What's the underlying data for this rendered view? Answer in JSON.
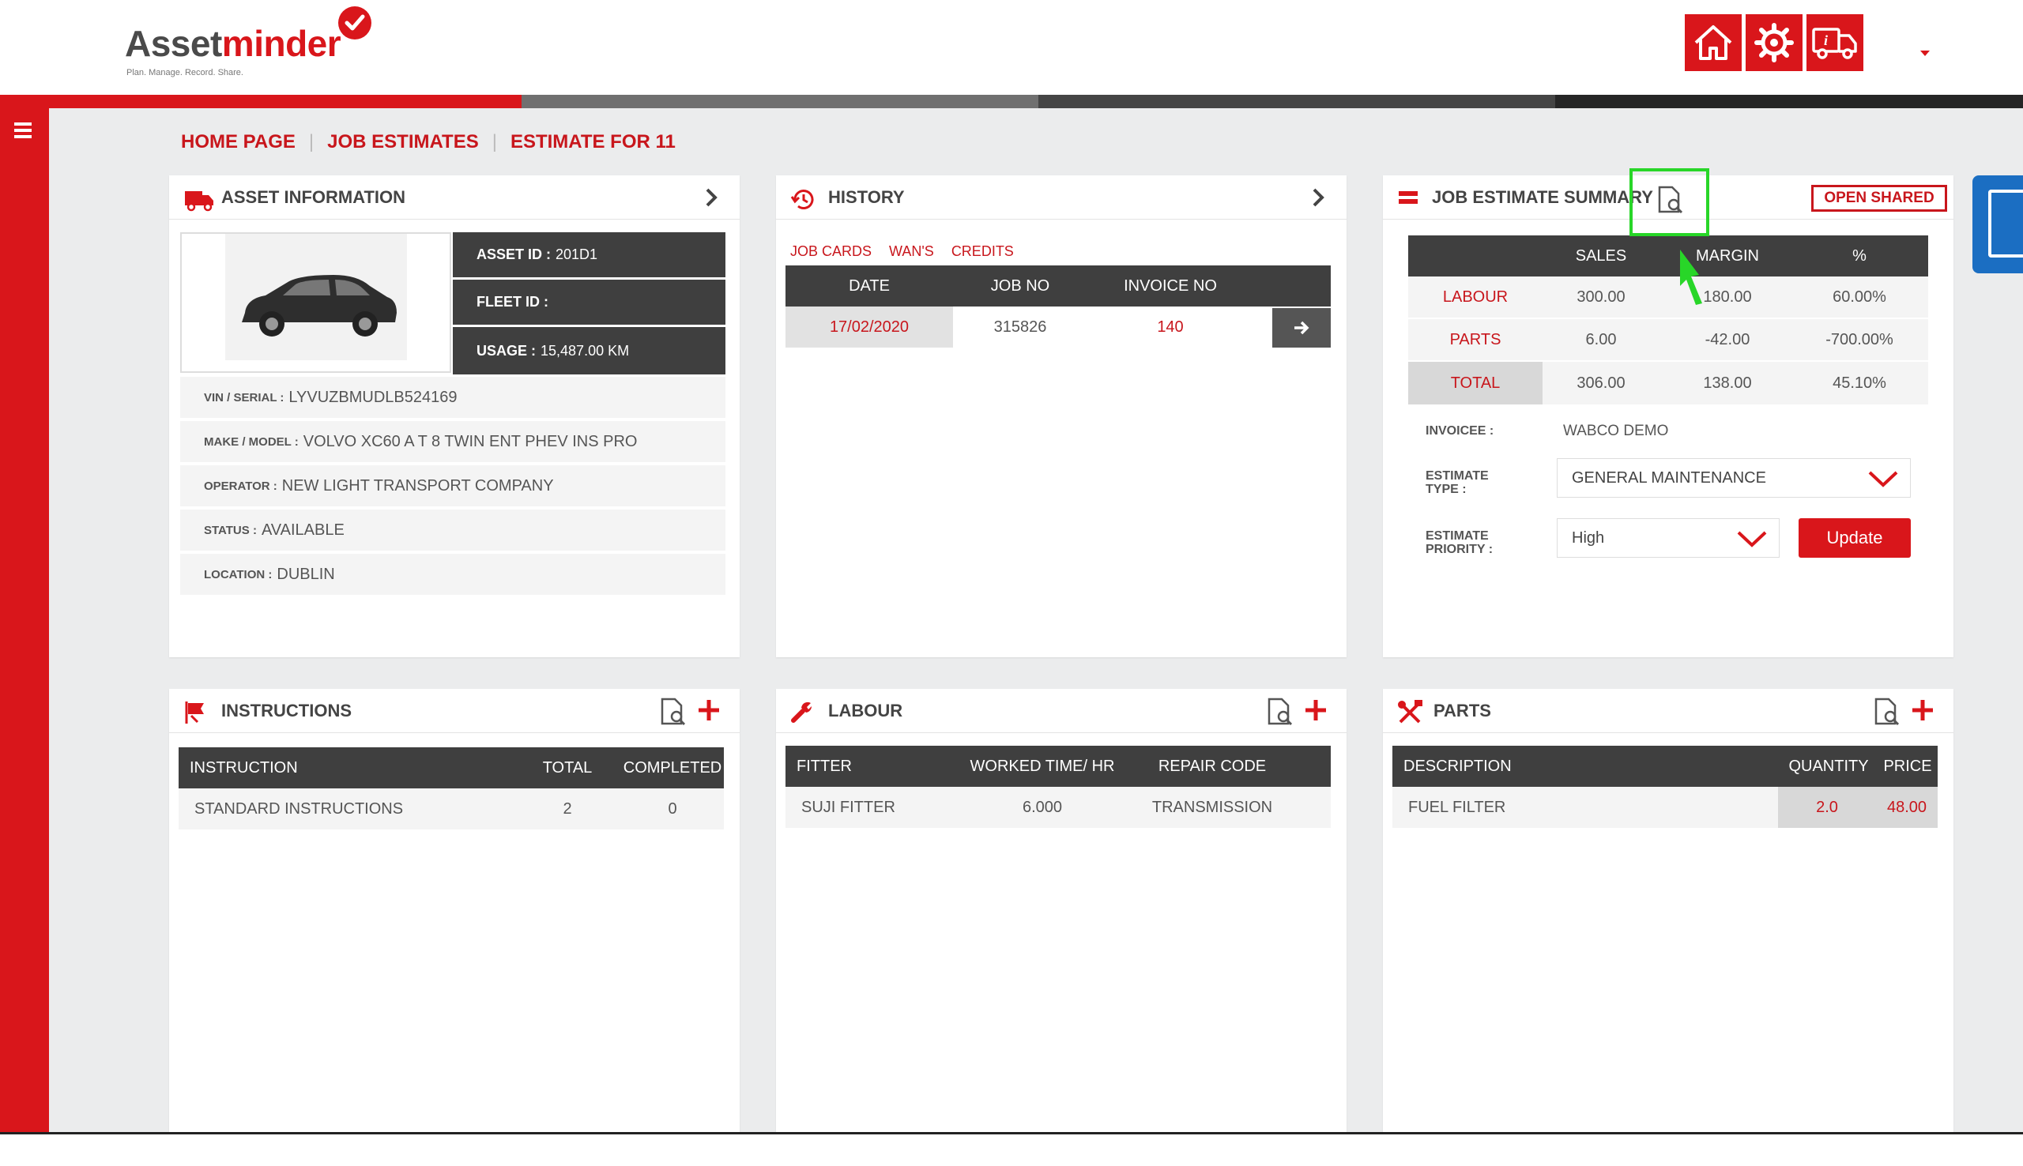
{
  "header": {
    "logo_prefix": "Asset",
    "logo_suffix": "minder",
    "logo_tagline": "Plan. Manage. Record. Share.",
    "buttons": [
      {
        "icon": "home-icon"
      },
      {
        "icon": "settings-gear-icon"
      },
      {
        "icon": "truck-info-icon"
      }
    ]
  },
  "colors": {
    "brand_red": "#d9161b",
    "dark": "#3f3f3f",
    "highlight": "#28d628",
    "side_tab": "#1b6ec2"
  },
  "breadcrumb": {
    "items": [
      "HOME PAGE",
      "JOB ESTIMATES",
      "ESTIMATE FOR 11"
    ],
    "separator": "|"
  },
  "asset": {
    "title": "ASSET INFORMATION",
    "asset_id_label": "ASSET ID :",
    "asset_id": "201D1",
    "fleet_id_label": "FLEET ID :",
    "fleet_id": "",
    "usage_label": "USAGE :",
    "usage": "15,487.00 KM",
    "vin_label": "VIN / SERIAL :",
    "vin": "LYVUZBMUDLB524169",
    "make_label": "MAKE / MODEL :",
    "make": "VOLVO XC60 A T 8 TWIN ENT PHEV INS PRO",
    "operator_label": "OPERATOR :",
    "operator": "NEW LIGHT TRANSPORT COMPANY",
    "status_label": "STATUS :",
    "status": "AVAILABLE",
    "location_label": "LOCATION :",
    "location": "DUBLIN"
  },
  "history": {
    "title": "HISTORY",
    "tabs": [
      "JOB CARDS",
      "WAN'S",
      "CREDITS"
    ],
    "columns": [
      "DATE",
      "JOB NO",
      "INVOICE NO"
    ],
    "rows": [
      {
        "date": "17/02/2020",
        "job_no": "315826",
        "invoice_no": "140"
      }
    ]
  },
  "summary": {
    "title": "JOB ESTIMATE SUMMARY",
    "open_shared": "OPEN SHARED",
    "columns": [
      "SALES",
      "MARGIN",
      "%"
    ],
    "rows": [
      {
        "label": "LABOUR",
        "sales": "300.00",
        "margin": "180.00",
        "pct": "60.00%"
      },
      {
        "label": "PARTS",
        "sales": "6.00",
        "margin": "-42.00",
        "pct": "-700.00%"
      },
      {
        "label": "TOTAL",
        "sales": "306.00",
        "margin": "138.00",
        "pct": "45.10%"
      }
    ],
    "invoicee_label": "INVOICEE :",
    "invoicee": "WABCO DEMO",
    "estimate_type_label_1": "ESTIMATE",
    "estimate_type_label_2": "TYPE :",
    "estimate_type": "GENERAL MAINTENANCE",
    "estimate_priority_label_1": "ESTIMATE",
    "estimate_priority_label_2": "PRIORITY :",
    "estimate_priority": "High",
    "update_label": "Update"
  },
  "instructions": {
    "title": "INSTRUCTIONS",
    "columns": [
      "INSTRUCTION",
      "TOTAL",
      "COMPLETED"
    ],
    "rows": [
      {
        "instruction": "STANDARD INSTRUCTIONS",
        "total": "2",
        "completed": "0"
      }
    ]
  },
  "labour": {
    "title": "LABOUR",
    "columns": [
      "FITTER",
      "WORKED TIME/ HR",
      "REPAIR CODE"
    ],
    "rows": [
      {
        "fitter": "SUJI FITTER",
        "time": "6.000",
        "code": "TRANSMISSION"
      }
    ]
  },
  "parts": {
    "title": "PARTS",
    "columns": [
      "DESCRIPTION",
      "QUANTITY",
      "PRICE"
    ],
    "rows": [
      {
        "description": "FUEL FILTER",
        "quantity": "2.0",
        "price": "48.00"
      }
    ]
  }
}
